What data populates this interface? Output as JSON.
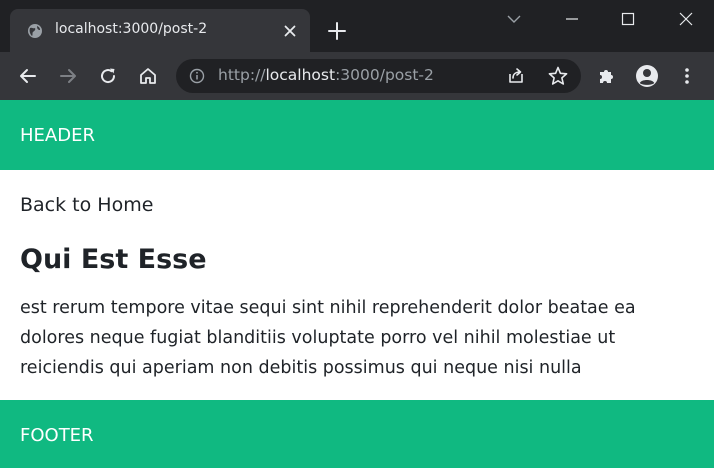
{
  "browser": {
    "tab": {
      "title": "localhost:3000/post-2"
    },
    "omnibox": {
      "url_scheme": "http://",
      "url_host": "localhost",
      "url_rest": ":3000/post-2"
    },
    "icons": [
      "globe-icon",
      "close-icon",
      "plus-icon",
      "chevron-down-icon",
      "minimize-icon",
      "maximize-icon",
      "window-close-icon",
      "back-arrow-icon",
      "forward-arrow-icon",
      "reload-icon",
      "home-icon",
      "info-icon",
      "share-icon",
      "star-icon",
      "puzzle-icon",
      "profile-icon",
      "kebab-menu-icon"
    ],
    "colors": {
      "tabstrip": "#202124",
      "toolbar": "#35363a",
      "omnibox": "#202124"
    }
  },
  "page": {
    "header": {
      "text": "HEADER"
    },
    "back_link": {
      "text": "Back to Home"
    },
    "post": {
      "title": "Qui Est Esse",
      "body": "est rerum tempore vitae sequi sint nihil reprehenderit dolor beatae ea dolores neque fugiat blanditiis voluptate porro vel nihil molestiae ut reiciendis qui aperiam non debitis possimus qui neque nisi nulla"
    },
    "footer": {
      "text": "FOOTER"
    },
    "colors": {
      "accent": "#10b981",
      "text": "#1f2328",
      "background": "#ffffff"
    }
  }
}
